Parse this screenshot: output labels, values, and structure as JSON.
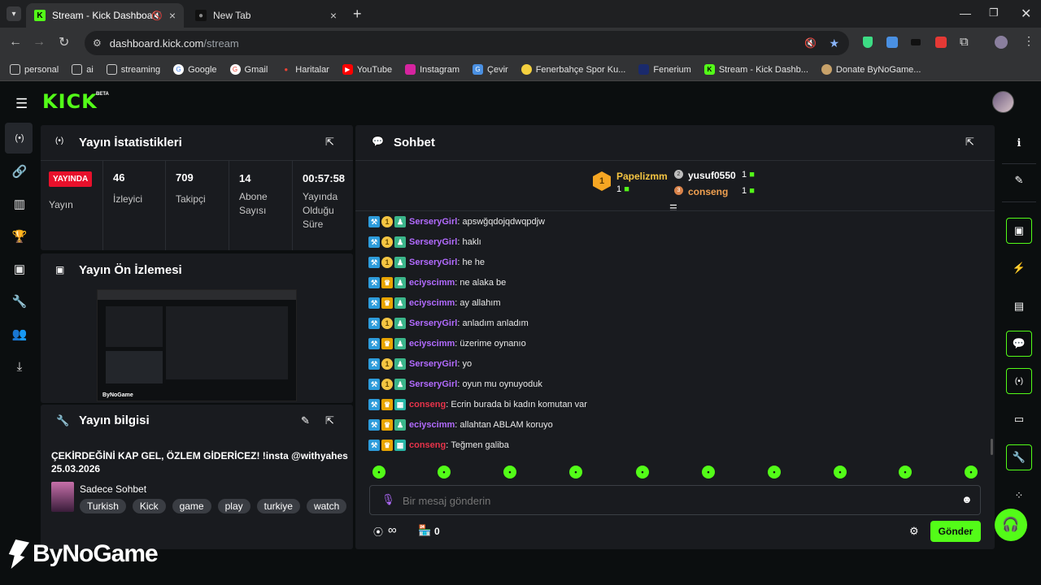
{
  "browser": {
    "tabs": [
      {
        "title": "Stream - Kick Dashboard",
        "active": true
      },
      {
        "title": "New Tab",
        "active": false
      }
    ],
    "url_domain": "dashboard.kick.com",
    "url_path": "/stream",
    "bookmarks": [
      "personal",
      "ai",
      "streaming",
      "Google",
      "Gmail",
      "Haritalar",
      "YouTube",
      "Instagram",
      "Çevir",
      "Fenerbahçe Spor Ku...",
      "Fenerium",
      "Stream - Kick Dashb...",
      "Donate ByNoGame..."
    ]
  },
  "app": {
    "logo": "KICK",
    "logo_badge": "BETA",
    "accent": "#53fc18"
  },
  "stats_panel": {
    "title": "Yayın İstatistikleri",
    "live_badge": "YAYINDA",
    "live_label": "Yayın",
    "stats": [
      {
        "value": "46",
        "label": "İzleyici"
      },
      {
        "value": "709",
        "label": "Takipçi"
      },
      {
        "value": "14",
        "label": "Abone Sayısı"
      },
      {
        "value": "00:57:58",
        "label": "Yayında Olduğu Süre"
      }
    ]
  },
  "preview_panel": {
    "title": "Yayın Ön İzlemesi"
  },
  "info_panel": {
    "title": "Yayın bilgisi",
    "stream_title": "ÇEKİRDEĞİNİ KAP GEL, ÖZLEM GİDERİCEZ! !insta @withyahes 25.03.2026",
    "category": "Sadece Sohbet",
    "tags": [
      "Turkish",
      "Kick",
      "game",
      "play",
      "turkiye",
      "watch"
    ]
  },
  "chat_panel": {
    "title": "Sohbet",
    "leaderboard": [
      {
        "rank": "1",
        "name": "Papelizmm",
        "count": "1"
      },
      {
        "rank": "2",
        "name": "yusuf0550",
        "count": "1"
      },
      {
        "rank": "3",
        "name": "conseng",
        "count": "1"
      }
    ],
    "messages": [
      {
        "user": "SerseryGirl",
        "text": "apswğqdojqdwqpdjw",
        "color": "#b26bff",
        "badges": [
          "mod",
          "sub",
          "av"
        ]
      },
      {
        "user": "SerseryGirl",
        "text": "haklı",
        "color": "#b26bff",
        "badges": [
          "mod",
          "sub",
          "av"
        ]
      },
      {
        "user": "SerseryGirl",
        "text": "he he",
        "color": "#b26bff",
        "badges": [
          "mod",
          "sub",
          "av"
        ]
      },
      {
        "user": "eciyscimm",
        "text": "ne alaka be",
        "color": "#b26bff",
        "badges": [
          "mod",
          "crown",
          "av"
        ]
      },
      {
        "user": "eciyscimm",
        "text": "ay allahım",
        "color": "#b26bff",
        "badges": [
          "mod",
          "crown",
          "av"
        ]
      },
      {
        "user": "SerseryGirl",
        "text": "anladım anladım",
        "color": "#b26bff",
        "badges": [
          "mod",
          "sub",
          "av"
        ]
      },
      {
        "user": "eciyscimm",
        "text": "üzerime oynanıo",
        "color": "#b26bff",
        "badges": [
          "mod",
          "crown",
          "av"
        ]
      },
      {
        "user": "SerseryGirl",
        "text": "yo",
        "color": "#b26bff",
        "badges": [
          "mod",
          "sub",
          "av"
        ]
      },
      {
        "user": "SerseryGirl",
        "text": "oyun mu oynuyoduk",
        "color": "#b26bff",
        "badges": [
          "mod",
          "sub",
          "av"
        ]
      },
      {
        "user": "conseng",
        "text": "Ecrin burada bi kadın komutan var",
        "color": "#e8334a",
        "badges": [
          "mod",
          "crown",
          "og"
        ]
      },
      {
        "user": "eciyscimm",
        "text": "allahtan ABLAM koruyo",
        "color": "#b26bff",
        "badges": [
          "mod",
          "crown",
          "av"
        ]
      },
      {
        "user": "conseng",
        "text": "Teğmen galiba",
        "color": "#e8334a",
        "badges": [
          "mod",
          "crown",
          "og"
        ]
      }
    ],
    "input_placeholder": "Bir mesaj gönderin",
    "points_label": "∞",
    "store_count": "0",
    "send_label": "Gönder"
  },
  "watermark": "ByNoGame"
}
